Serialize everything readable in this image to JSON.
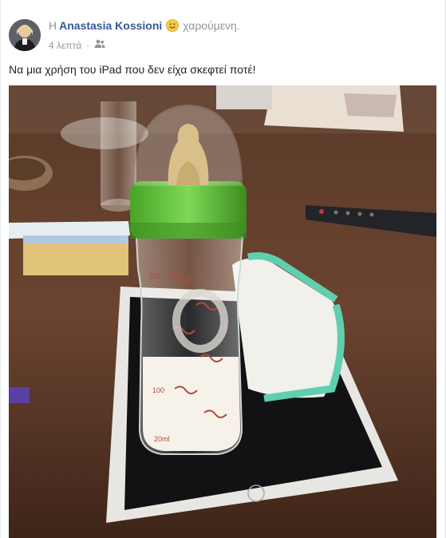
{
  "post": {
    "prefix": "Η",
    "author": "Anastasia Kossioni",
    "feeling": "χαρούμενη.",
    "time": "4 λεπτά",
    "audience_icon": "friends-icon",
    "text": "Να μια χρήση του iPad που δεν είχα σκεφτεί ποτέ!"
  },
  "photo": {
    "bottle_marks": [
      "150",
      "100",
      "20ml"
    ]
  },
  "colors": {
    "link": "#365899",
    "meta": "#90949c",
    "bottle_cap": "#6cc63a",
    "towel_trim": "#5fcfb0"
  }
}
